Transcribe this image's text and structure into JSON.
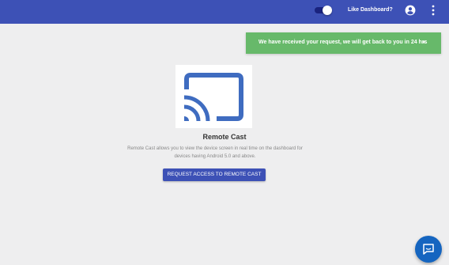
{
  "header": {
    "like_label": "Like Dashboard?",
    "toggle_on": true,
    "icons": [
      "toggle-switch",
      "account-circle-icon",
      "more-vert-icon"
    ]
  },
  "toast": {
    "message": "We have received your request, we will get back to you in 24 hrs",
    "close": "×"
  },
  "feature": {
    "icon": "cast-icon",
    "title": "Remote Cast",
    "description": "Remote Cast allows you to view the device screen in real time on the dashboard for devices having Android 5.0 and above.",
    "button_label": "REQUEST ACCESS TO REMOTE CAST"
  },
  "chat": {
    "icon": "chat-icon"
  },
  "colors": {
    "header": "#3d51b6",
    "toast": "#67b96a",
    "background": "#eeeeef",
    "accent": "#3f6cc0",
    "button": "#3d51b6",
    "fab": "#1565c0"
  }
}
